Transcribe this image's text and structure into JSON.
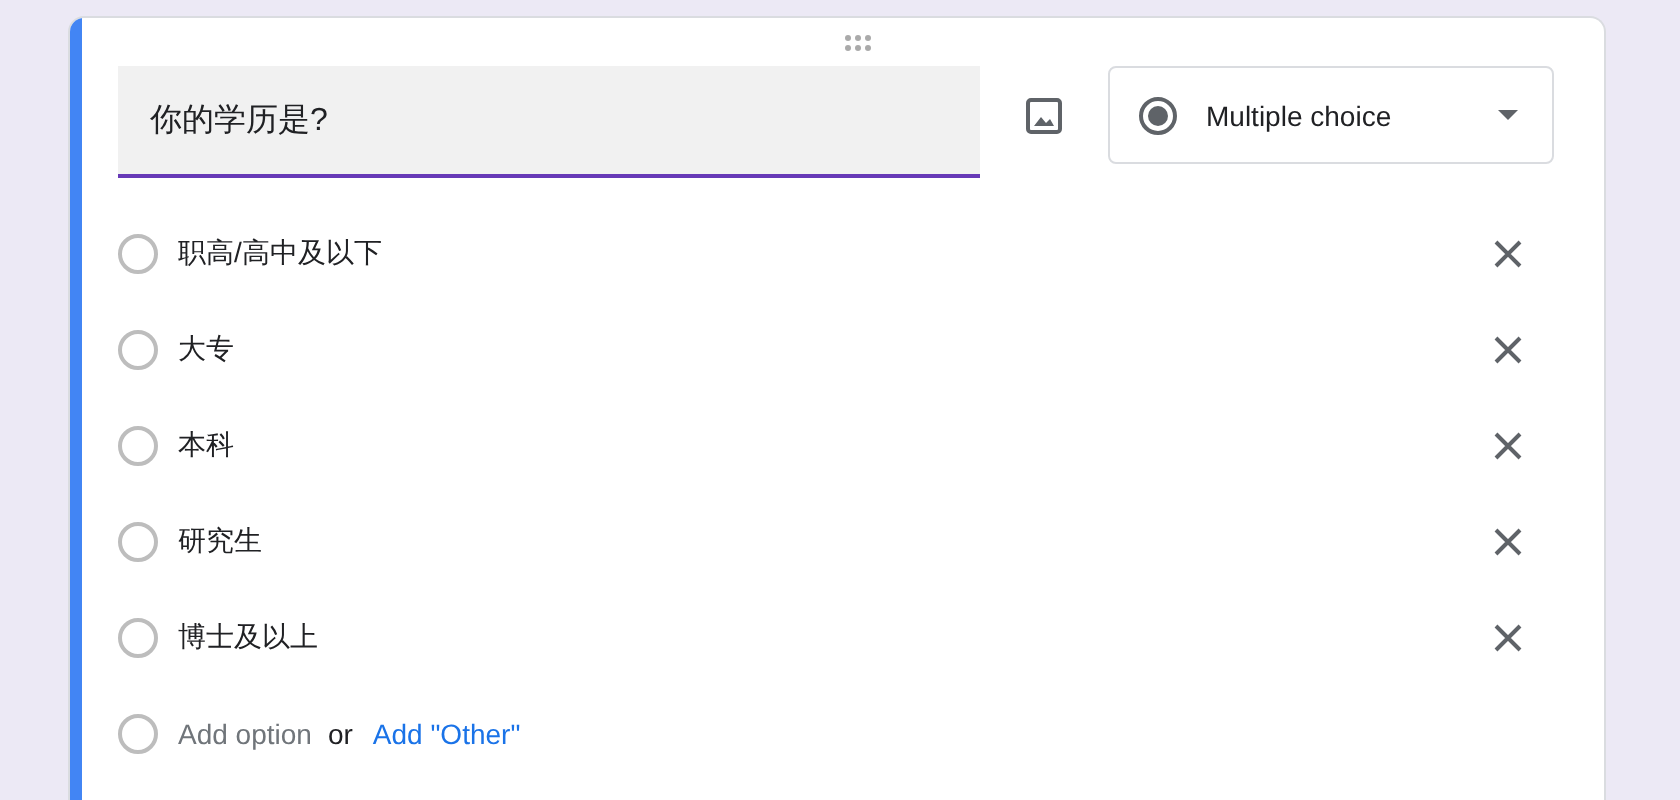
{
  "question": {
    "title": "你的学历是?",
    "focused": true
  },
  "question_type": {
    "label": "Multiple choice"
  },
  "options": [
    {
      "label": "职高/高中及以下",
      "checked": false
    },
    {
      "label": "大专",
      "checked": false
    },
    {
      "label": "本科",
      "checked": false
    },
    {
      "label": "研究生",
      "checked": false
    },
    {
      "label": "博士及以上",
      "checked": false
    }
  ],
  "add_row": {
    "checked": false,
    "add_option": "Add option",
    "or": "or",
    "add_other": "Add \"Other\""
  }
}
